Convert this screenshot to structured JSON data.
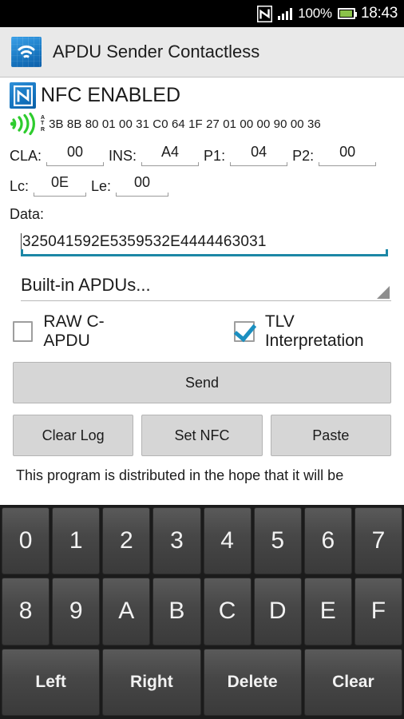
{
  "statusbar": {
    "nfc_icon": "nfc-n-icon",
    "signal_icon": "signal-bars-icon",
    "battery_percent": "100%",
    "battery_icon": "battery-charging-icon",
    "time": "18:43"
  },
  "actionbar": {
    "app_icon": "contactless-waves-icon",
    "title": "APDU Sender Contactless"
  },
  "nfc_status": {
    "logo_icon": "nfc-logo-icon",
    "label": "NFC ENABLED"
  },
  "atr": {
    "icon": "contactless-signal-icon",
    "tag_line1": "A",
    "tag_line2": "T",
    "tag_line3": "R",
    "value": "3B 8B 80 01 00 31 C0 64 1F 27 01 00 00 90 00 36"
  },
  "apdu_fields": {
    "cla_label": "CLA:",
    "cla_value": "00",
    "ins_label": "INS:",
    "ins_value": "A4",
    "p1_label": "P1:",
    "p1_value": "04",
    "p2_label": "P2:",
    "p2_value": "00",
    "lc_label": "Lc:",
    "lc_value": "0E",
    "le_label": "Le:",
    "le_value": "00",
    "data_label": "Data:",
    "data_value": "325041592E5359532E4444463031"
  },
  "spinner": {
    "selected": "Built-in APDUs...",
    "arrow_icon": "dropdown-triangle-icon"
  },
  "checkboxes": {
    "raw_capdu_label": "RAW C-APDU",
    "raw_capdu_checked": false,
    "tlv_label": "TLV Interpretation",
    "tlv_checked": true
  },
  "buttons": {
    "send": "Send",
    "clear_log": "Clear Log",
    "set_nfc": "Set NFC",
    "paste": "Paste"
  },
  "license": {
    "text": "This program is distributed in the hope that it will be"
  },
  "keyboard": {
    "row1": [
      "0",
      "1",
      "2",
      "3",
      "4",
      "5",
      "6",
      "7"
    ],
    "row2": [
      "8",
      "9",
      "A",
      "B",
      "C",
      "D",
      "E",
      "F"
    ],
    "row3": [
      "Left",
      "Right",
      "Delete",
      "Clear"
    ]
  },
  "colors": {
    "accent": "#1c87a6",
    "checkbox_check": "#1b8fc0",
    "actionbar_bg": "#e9e9e9",
    "button_bg": "#d6d6d6",
    "keyboard_bg": "#1b1b1b",
    "battery_green": "#8bc34a"
  }
}
